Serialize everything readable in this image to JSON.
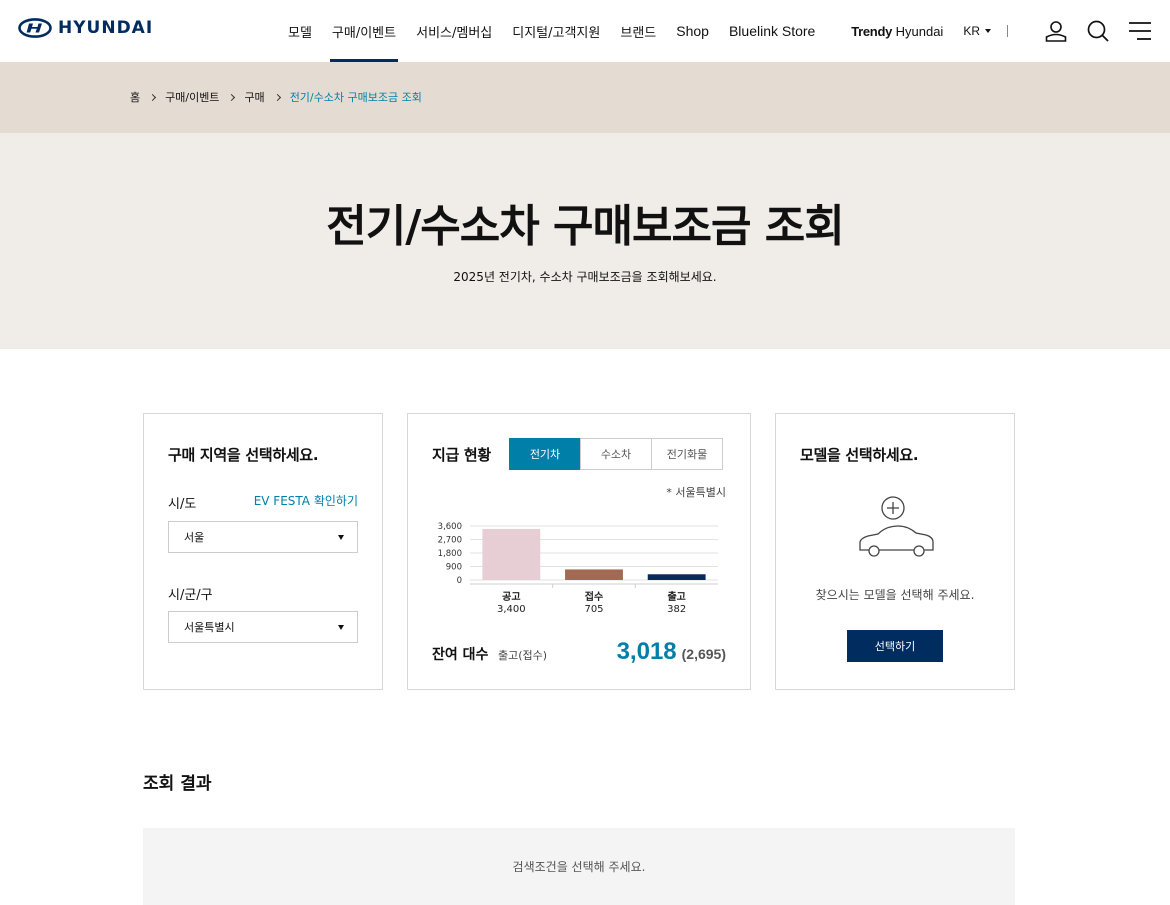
{
  "header": {
    "logo_text": "HYUNDAI",
    "nav": [
      "모델",
      "구매/이벤트",
      "서비스/멤버십",
      "디지털/고객지원",
      "브랜드",
      "Shop",
      "Bluelink Store"
    ],
    "trendy_bold": "Trendy",
    "trendy_rest": " Hyundai",
    "lang": "KR"
  },
  "breadcrumb": [
    "홈",
    "구매/이벤트",
    "구매",
    "전기/수소차 구매보조금 조회"
  ],
  "hero": {
    "title": "전기/수소차 구매보조금 조회",
    "subtitle": "2025년 전기차, 수소차 구매보조금을 조회해보세요."
  },
  "region_card": {
    "title": "구매 지역을 선택하세요.",
    "sido_label": "시/도",
    "ev_festa_link": "EV FESTA 확인하기",
    "sido_value": "서울",
    "sigungu_label": "시/군/구",
    "sigungu_value": "서울특별시"
  },
  "status_card": {
    "title": "지급 현황",
    "tabs": [
      "전기차",
      "수소차",
      "전기화물"
    ],
    "region_note": "* 서울특별시",
    "remain_label": "잔여 대수",
    "remain_sub": "출고(접수)",
    "remain_value": "3,018",
    "remain_paren": "(2,695)"
  },
  "chart_data": {
    "type": "bar",
    "categories": [
      "공고",
      "접수",
      "출고"
    ],
    "values": [
      3400,
      705,
      382
    ],
    "value_labels": [
      "3,400",
      "705",
      "382"
    ],
    "colors": [
      "#e6ced4",
      "#a36a53",
      "#0b2a5b"
    ],
    "yticks": [
      "3,600",
      "2,700",
      "1,800",
      "900",
      "0"
    ],
    "ylim": [
      0,
      3600
    ]
  },
  "model_card": {
    "title": "모델을 선택하세요.",
    "message": "찾으시는 모델을 선택해 주세요.",
    "button": "선택하기"
  },
  "result": {
    "title": "조회 결과",
    "empty": "검색조건을 선택해 주세요."
  }
}
